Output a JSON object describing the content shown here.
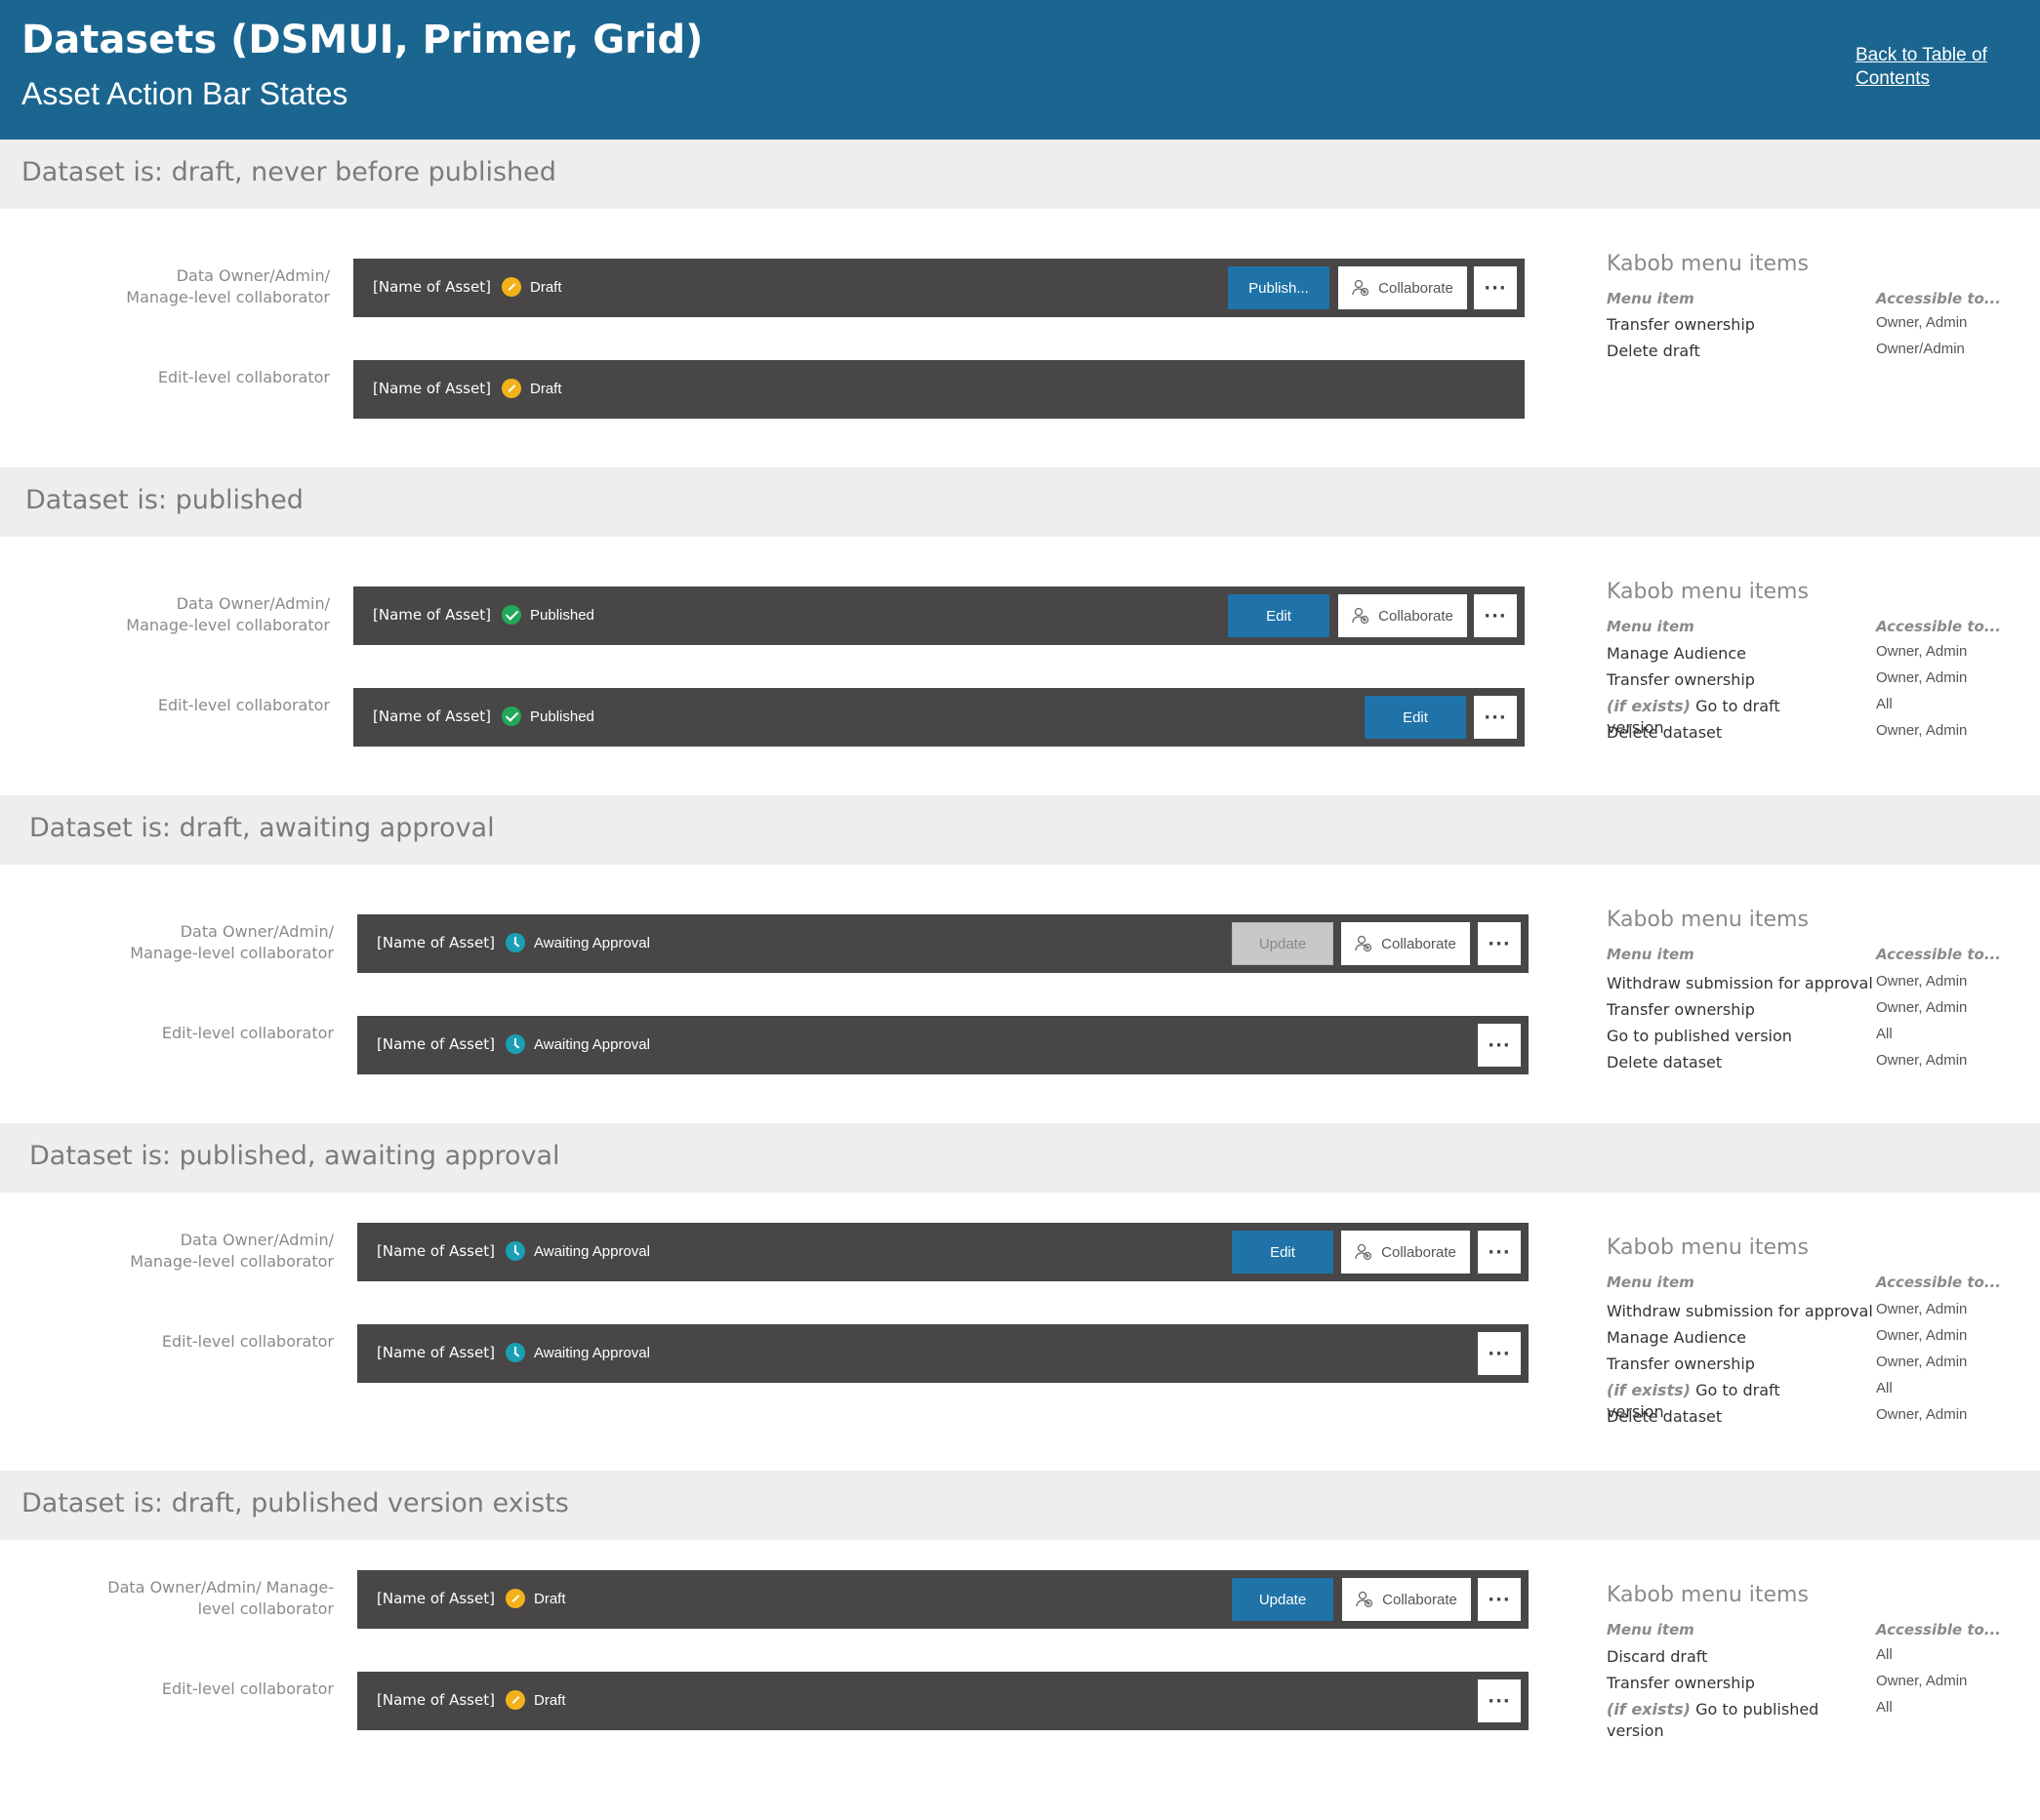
{
  "header": {
    "title": "Datasets (DSMUI, Primer, Grid)",
    "subtitle": "Asset Action Bar States",
    "back_link": "Back to Table of Contents"
  },
  "colors": {
    "header_bg": "#1b6690",
    "bar_bg": "#484646",
    "primary_button": "#1f73a8",
    "draft_status": "#f3b21a",
    "published_status": "#22a85a",
    "awaiting_status": "#1aa0b4"
  },
  "common": {
    "asset_name": "[Name of Asset]",
    "collaborate_label": "Collaborate",
    "kabob_glyph": "···",
    "kabob_title": "Kabob menu items",
    "col_menu_item": "Menu item",
    "col_accessible": "Accessible to..."
  },
  "sections": [
    {
      "title": "Dataset is: draft, never before published",
      "owner_role": "Data Owner/Admin/ Manage-level collaborator",
      "editor_role": "Edit-level collaborator",
      "owner_status": "Draft",
      "editor_status": "Draft",
      "owner_primary_button": "Publish...",
      "menu": [
        {
          "item": "Transfer ownership",
          "access": "Owner, Admin"
        },
        {
          "item": "Delete draft",
          "access": "Owner/Admin"
        }
      ]
    },
    {
      "title": "Dataset is: published",
      "owner_role": "Data Owner/Admin/ Manage-level collaborator",
      "editor_role": "Edit-level collaborator",
      "owner_status": "Published",
      "editor_status": "Published",
      "owner_primary_button": "Edit",
      "editor_primary_button": "Edit",
      "menu": [
        {
          "item": "Manage Audience",
          "access": "Owner, Admin"
        },
        {
          "item": "Transfer ownership",
          "access": "Owner, Admin"
        },
        {
          "qualifier": "(if exists)",
          "item": "Go to draft version",
          "access": "All"
        },
        {
          "item": "Delete dataset",
          "access": "Owner, Admin"
        }
      ]
    },
    {
      "title": "Dataset is: draft, awaiting approval",
      "owner_role": "Data Owner/Admin/ Manage-level collaborator",
      "editor_role": "Edit-level collaborator",
      "owner_status": "Awaiting Approval",
      "editor_status": "Awaiting Approval",
      "owner_primary_button": "Update",
      "menu": [
        {
          "item": "Withdraw submission for approval",
          "access": "Owner, Admin"
        },
        {
          "item": "Transfer ownership",
          "access": "Owner, Admin"
        },
        {
          "item": "Go to published version",
          "access": "All"
        },
        {
          "item": "Delete dataset",
          "access": "Owner, Admin"
        }
      ]
    },
    {
      "title": "Dataset is: published, awaiting approval",
      "owner_role": "Data Owner/Admin/ Manage-level collaborator",
      "editor_role": "Edit-level collaborator",
      "owner_status": "Awaiting Approval",
      "editor_status": "Awaiting Approval",
      "owner_primary_button": "Edit",
      "menu": [
        {
          "item": "Withdraw submission for approval",
          "access": "Owner, Admin"
        },
        {
          "item": "Manage Audience",
          "access": "Owner, Admin"
        },
        {
          "item": "Transfer ownership",
          "access": "Owner, Admin"
        },
        {
          "qualifier": "(if exists)",
          "item": "Go to draft version",
          "access": "All"
        },
        {
          "item": "Delete dataset",
          "access": "Owner, Admin"
        }
      ]
    },
    {
      "title": "Dataset is: draft, published version exists",
      "owner_role": "Data Owner/Admin/ Manage-level collaborator",
      "editor_role": "Edit-level collaborator",
      "owner_status": "Draft",
      "editor_status": "Draft",
      "owner_primary_button": "Update",
      "menu": [
        {
          "item": "Discard draft",
          "access": "All"
        },
        {
          "item": "Transfer ownership",
          "access": "Owner, Admin"
        },
        {
          "qualifier": "(if exists)",
          "item": "Go to published version",
          "access": "All"
        }
      ]
    }
  ]
}
